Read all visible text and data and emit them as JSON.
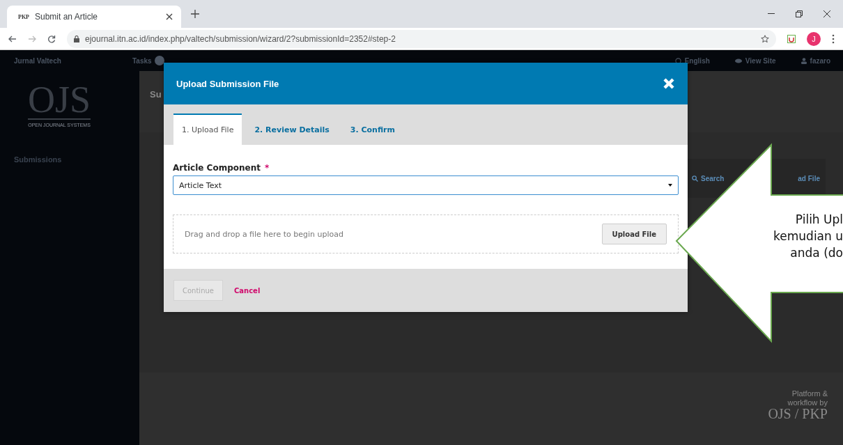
{
  "browser": {
    "tab": {
      "favicon": "PKP",
      "title": "Submit an Article"
    },
    "url": "ejournal.itn.ac.id/index.php/valtech/submission/wizard/2?submissionId=2352#step-2",
    "profile_initial": "J"
  },
  "header": {
    "journal": "Jurnal Valtech",
    "tasks": "Tasks",
    "links": [
      {
        "kind": "language",
        "label": "English"
      },
      {
        "kind": "view",
        "label": "View Site"
      },
      {
        "kind": "user",
        "label": "fazaro"
      }
    ]
  },
  "sidebar": {
    "logo": "OJS",
    "tagline": "OPEN JOURNAL SYSTEMS",
    "items": [
      {
        "label": "Submissions"
      }
    ]
  },
  "main": {
    "title": "Su",
    "search": "Search",
    "upload_button": "ad File",
    "footer": {
      "lines": [
        "Platform &",
        "workflow by"
      ],
      "logo": "OJS / PKP"
    }
  },
  "modal": {
    "title": "Upload Submission File",
    "tabs": [
      {
        "label": "1. Upload File",
        "selected": true
      },
      {
        "label": "2. Review Details",
        "selected": false
      },
      {
        "label": "3. Confirm",
        "selected": false
      }
    ],
    "field_label": "Article Component",
    "required_mark": "*",
    "select_value": "Article Text",
    "dropzone_text": "Drag and drop a file here to begin upload",
    "upload_button": "Upload File",
    "continue": {
      "label": "Continue",
      "disabled": true
    },
    "cancel": "Cancel"
  },
  "callout": {
    "lines": [
      "Pilih Upl",
      "kemudian u",
      "anda (do"
    ]
  }
}
